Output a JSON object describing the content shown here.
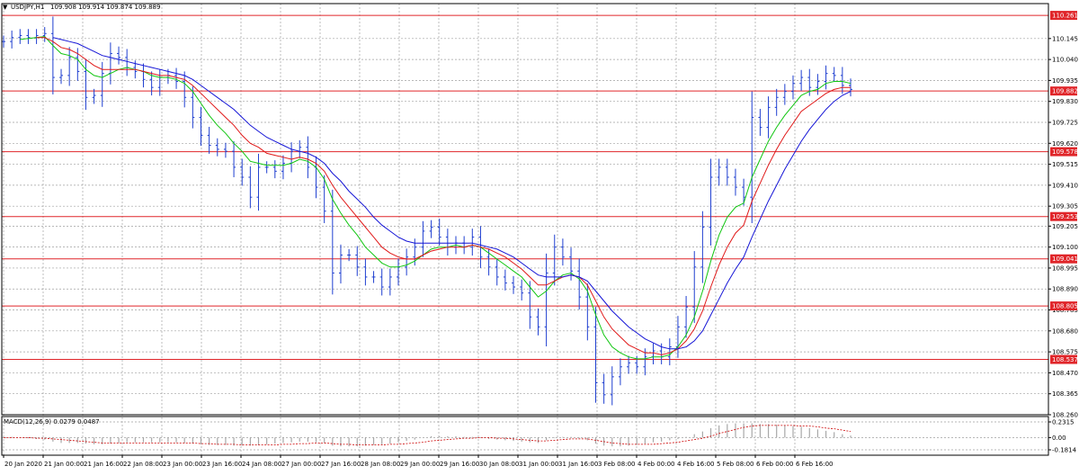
{
  "header": {
    "symbol": "USDJPY,H1",
    "ohlc": "109.908 109.914 109.874 109.889"
  },
  "subwindow": {
    "indicator": "MACD(12,26,9) 0.0279 0.0487"
  },
  "colors": {
    "background": "#ffffff",
    "bar": "#1f3fd0",
    "ma_fast": "#11c611",
    "ma_mid": "#e01818",
    "ma_slow": "#1515d6",
    "level_line": "#e0262a",
    "level_label_bg": "#e0262a",
    "grid": "#a0a0a0",
    "macd_hist": "#a8a8a8",
    "macd_signal": "#cc0000"
  },
  "chart_data": [
    {
      "type": "line",
      "title": "USDJPY,H1",
      "xlabel": "",
      "ylabel": "",
      "ylim": [
        108.26,
        110.32
      ],
      "grid": true,
      "y_ticks": [
        110.145,
        110.04,
        109.935,
        109.83,
        109.725,
        109.62,
        109.515,
        109.41,
        109.305,
        109.205,
        109.1,
        108.995,
        108.89,
        108.785,
        108.68,
        108.575,
        108.47,
        108.365,
        108.26
      ],
      "x_ticks": [
        "20 Jan 2020",
        "21 Jan 00:00",
        "21 Jan 16:00",
        "22 Jan 08:00",
        "23 Jan 00:00",
        "23 Jan 16:00",
        "24 Jan 08:00",
        "27 Jan 00:00",
        "27 Jan 16:00",
        "28 Jan 08:00",
        "29 Jan 00:00",
        "29 Jan 16:00",
        "30 Jan 08:00",
        "31 Jan 00:00",
        "31 Jan 16:00",
        "3 Feb 08:00",
        "4 Feb 00:00",
        "4 Feb 16:00",
        "5 Feb 08:00",
        "6 Feb 00:00",
        "6 Feb 16:00"
      ],
      "price_levels": [
        110.261,
        109.882,
        109.578,
        109.253,
        109.041,
        108.805,
        108.537
      ],
      "series": [
        {
          "values": [
            110.13,
            110.15,
            110.16,
            110.15,
            110.16,
            110.17,
            109.95,
            109.96,
            110.05,
            109.98,
            109.85,
            109.86,
            109.97,
            110.07,
            110.05,
            110.0,
            109.98,
            109.94,
            109.9,
            109.95,
            109.96,
            109.93,
            109.85,
            109.75,
            109.66,
            109.61,
            109.59,
            109.58,
            109.5,
            109.45,
            109.35,
            109.5,
            109.5,
            109.48,
            109.52,
            109.58,
            109.6,
            109.5,
            109.4,
            109.28,
            108.97,
            109.06,
            109.06,
            109.0,
            108.95,
            108.95,
            108.9,
            108.95,
            109.0,
            109.05,
            109.1,
            109.18,
            109.2,
            109.15,
            109.1,
            109.12,
            109.1,
            109.15,
            109.05,
            109.0,
            108.95,
            108.92,
            108.9,
            108.87,
            108.75,
            108.7,
            108.97,
            109.1,
            109.05,
            108.98,
            108.85,
            108.7,
            108.42,
            108.36,
            108.45,
            108.5,
            108.52,
            108.5,
            108.55,
            108.58,
            108.55,
            108.6,
            108.7,
            108.8,
            109.0,
            109.2,
            109.45,
            109.5,
            109.45,
            109.4,
            109.35,
            109.75,
            109.7,
            109.8,
            109.85,
            109.88,
            109.92,
            109.95,
            109.9,
            109.93,
            109.97,
            109.96,
            109.91,
            109.89
          ]
        },
        {
          "values": [
            null,
            null,
            110.14,
            110.145,
            110.15,
            110.155,
            110.11,
            110.07,
            110.06,
            110.04,
            109.99,
            109.96,
            109.95,
            109.97,
            109.99,
            110.0,
            109.99,
            109.98,
            109.96,
            109.95,
            109.95,
            109.94,
            109.92,
            109.88,
            109.82,
            109.76,
            109.71,
            109.67,
            109.62,
            109.58,
            109.53,
            109.52,
            109.51,
            109.51,
            109.51,
            109.52,
            109.54,
            109.53,
            109.5,
            109.44,
            109.34,
            109.27,
            109.21,
            109.16,
            109.1,
            109.06,
            109.02,
            109.0,
            109.0,
            109.01,
            109.03,
            109.06,
            109.09,
            109.1,
            109.1,
            109.11,
            109.1,
            109.11,
            109.1,
            109.07,
            109.04,
            109.01,
            108.98,
            108.95,
            108.9,
            108.85,
            108.88,
            108.93,
            108.96,
            108.97,
            108.94,
            108.88,
            108.76,
            108.66,
            108.6,
            108.57,
            108.55,
            108.54,
            108.54,
            108.55,
            108.55,
            108.56,
            108.6,
            108.66,
            108.75,
            108.88,
            109.03,
            109.16,
            109.25,
            109.3,
            109.32,
            109.45,
            109.54,
            109.63,
            109.7,
            109.76,
            109.81,
            109.86,
            109.88,
            109.89,
            109.92,
            109.93,
            109.93,
            109.92
          ]
        },
        {
          "values": [
            null,
            null,
            null,
            null,
            110.15,
            110.15,
            110.13,
            110.1,
            110.09,
            110.07,
            110.04,
            110.01,
            109.99,
            109.99,
            109.99,
            109.99,
            109.99,
            109.98,
            109.97,
            109.96,
            109.96,
            109.95,
            109.94,
            109.91,
            109.87,
            109.83,
            109.79,
            109.75,
            109.71,
            109.66,
            109.62,
            109.6,
            109.57,
            109.56,
            109.55,
            109.54,
            109.55,
            109.54,
            109.52,
            109.48,
            109.41,
            109.35,
            109.3,
            109.25,
            109.2,
            109.15,
            109.1,
            109.07,
            109.05,
            109.04,
            109.04,
            109.06,
            109.08,
            109.09,
            109.1,
            109.1,
            109.1,
            109.11,
            109.1,
            109.09,
            109.07,
            109.05,
            109.02,
            108.99,
            108.95,
            108.91,
            108.91,
            108.93,
            108.95,
            108.96,
            108.95,
            108.91,
            108.83,
            108.75,
            108.69,
            108.65,
            108.61,
            108.59,
            108.57,
            108.57,
            108.56,
            108.57,
            108.59,
            108.63,
            108.69,
            108.78,
            108.9,
            109.01,
            109.1,
            109.17,
            109.21,
            109.33,
            109.42,
            109.51,
            109.59,
            109.66,
            109.72,
            109.78,
            109.81,
            109.84,
            109.87,
            109.89,
            109.9,
            109.9
          ]
        },
        {
          "values": [
            null,
            null,
            null,
            null,
            null,
            null,
            110.15,
            110.14,
            110.13,
            110.12,
            110.1,
            110.08,
            110.06,
            110.05,
            110.04,
            110.03,
            110.02,
            110.01,
            110.0,
            109.99,
            109.98,
            109.97,
            109.96,
            109.94,
            109.91,
            109.88,
            109.85,
            109.82,
            109.79,
            109.75,
            109.71,
            109.68,
            109.65,
            109.63,
            109.61,
            109.59,
            109.58,
            109.57,
            109.55,
            109.52,
            109.47,
            109.43,
            109.38,
            109.34,
            109.3,
            109.25,
            109.21,
            109.18,
            109.15,
            109.13,
            109.12,
            109.12,
            109.12,
            109.12,
            109.12,
            109.12,
            109.12,
            109.12,
            109.11,
            109.1,
            109.09,
            109.07,
            109.05,
            109.02,
            108.99,
            108.96,
            108.95,
            108.95,
            108.95,
            108.96,
            108.95,
            108.93,
            108.88,
            108.83,
            108.78,
            108.74,
            108.7,
            108.67,
            108.64,
            108.62,
            108.6,
            108.59,
            108.59,
            108.6,
            108.63,
            108.68,
            108.76,
            108.84,
            108.92,
            108.99,
            109.05,
            109.15,
            109.24,
            109.33,
            109.41,
            109.49,
            109.56,
            109.63,
            109.69,
            109.74,
            109.79,
            109.83,
            109.86,
            109.88
          ]
        }
      ]
    },
    {
      "type": "bar",
      "title": "MACD(12,26,9) 0.0279 0.0487",
      "ylim": [
        -0.1814,
        0.2315
      ],
      "y_ticks": [
        0.2315,
        0.0,
        -0.1814
      ],
      "series": [
        {
          "values": [
            0.01,
            0.01,
            0.0,
            -0.01,
            -0.02,
            -0.03,
            -0.06,
            -0.08,
            -0.08,
            -0.08,
            -0.09,
            -0.1,
            -0.1,
            -0.09,
            -0.08,
            -0.07,
            -0.07,
            -0.07,
            -0.07,
            -0.07,
            -0.07,
            -0.07,
            -0.08,
            -0.09,
            -0.1,
            -0.11,
            -0.11,
            -0.11,
            -0.12,
            -0.12,
            -0.12,
            -0.11,
            -0.1,
            -0.09,
            -0.08,
            -0.07,
            -0.06,
            -0.06,
            -0.07,
            -0.08,
            -0.12,
            -0.13,
            -0.13,
            -0.13,
            -0.12,
            -0.11,
            -0.1,
            -0.09,
            -0.07,
            -0.05,
            -0.03,
            0.0,
            0.02,
            0.02,
            0.02,
            0.02,
            0.01,
            0.01,
            0.0,
            -0.02,
            -0.03,
            -0.04,
            -0.05,
            -0.06,
            -0.07,
            -0.08,
            -0.04,
            -0.01,
            0.01,
            0.01,
            -0.01,
            -0.04,
            -0.09,
            -0.12,
            -0.13,
            -0.13,
            -0.12,
            -0.11,
            -0.09,
            -0.07,
            -0.06,
            -0.04,
            -0.02,
            0.01,
            0.05,
            0.09,
            0.14,
            0.18,
            0.2,
            0.21,
            0.21,
            0.21,
            0.2,
            0.2,
            0.19,
            0.18,
            0.17,
            0.16,
            0.14,
            0.12,
            0.1,
            0.08,
            0.05,
            0.03
          ]
        },
        {
          "values": [
            0.0,
            0.0,
            0.0,
            0.0,
            -0.01,
            -0.01,
            -0.02,
            -0.03,
            -0.04,
            -0.05,
            -0.06,
            -0.07,
            -0.08,
            -0.08,
            -0.08,
            -0.08,
            -0.08,
            -0.08,
            -0.08,
            -0.08,
            -0.08,
            -0.08,
            -0.08,
            -0.08,
            -0.09,
            -0.09,
            -0.1,
            -0.1,
            -0.1,
            -0.11,
            -0.11,
            -0.11,
            -0.11,
            -0.11,
            -0.1,
            -0.1,
            -0.09,
            -0.09,
            -0.08,
            -0.08,
            -0.09,
            -0.1,
            -0.1,
            -0.11,
            -0.11,
            -0.11,
            -0.11,
            -0.1,
            -0.1,
            -0.09,
            -0.08,
            -0.07,
            -0.05,
            -0.04,
            -0.03,
            -0.02,
            -0.01,
            -0.01,
            0.0,
            0.0,
            -0.01,
            -0.01,
            -0.02,
            -0.03,
            -0.04,
            -0.05,
            -0.05,
            -0.04,
            -0.03,
            -0.02,
            -0.02,
            -0.02,
            -0.04,
            -0.06,
            -0.08,
            -0.09,
            -0.1,
            -0.1,
            -0.1,
            -0.1,
            -0.09,
            -0.08,
            -0.07,
            -0.05,
            -0.03,
            -0.01,
            0.02,
            0.06,
            0.09,
            0.12,
            0.15,
            0.17,
            0.18,
            0.18,
            0.18,
            0.18,
            0.18,
            0.17,
            0.17,
            0.16,
            0.14,
            0.13,
            0.11,
            0.09
          ]
        }
      ]
    }
  ]
}
